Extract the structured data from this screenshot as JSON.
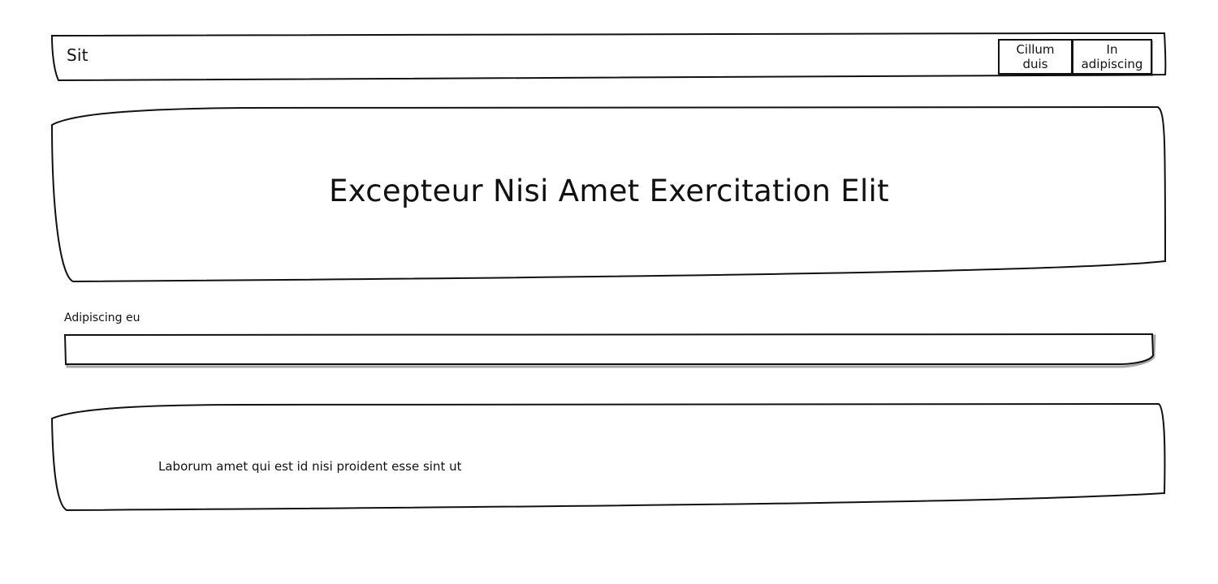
{
  "header": {
    "brand": "Sit",
    "nav": [
      {
        "label": "Cillum duis"
      },
      {
        "label": "In adipiscing"
      }
    ]
  },
  "hero": {
    "title": "Excepteur Nisi Amet Exercitation Elit"
  },
  "form": {
    "label": "Adipiscing eu",
    "value": "",
    "placeholder": ""
  },
  "content": {
    "text": "Laborum amet qui est id nisi proident esse sint ut"
  }
}
